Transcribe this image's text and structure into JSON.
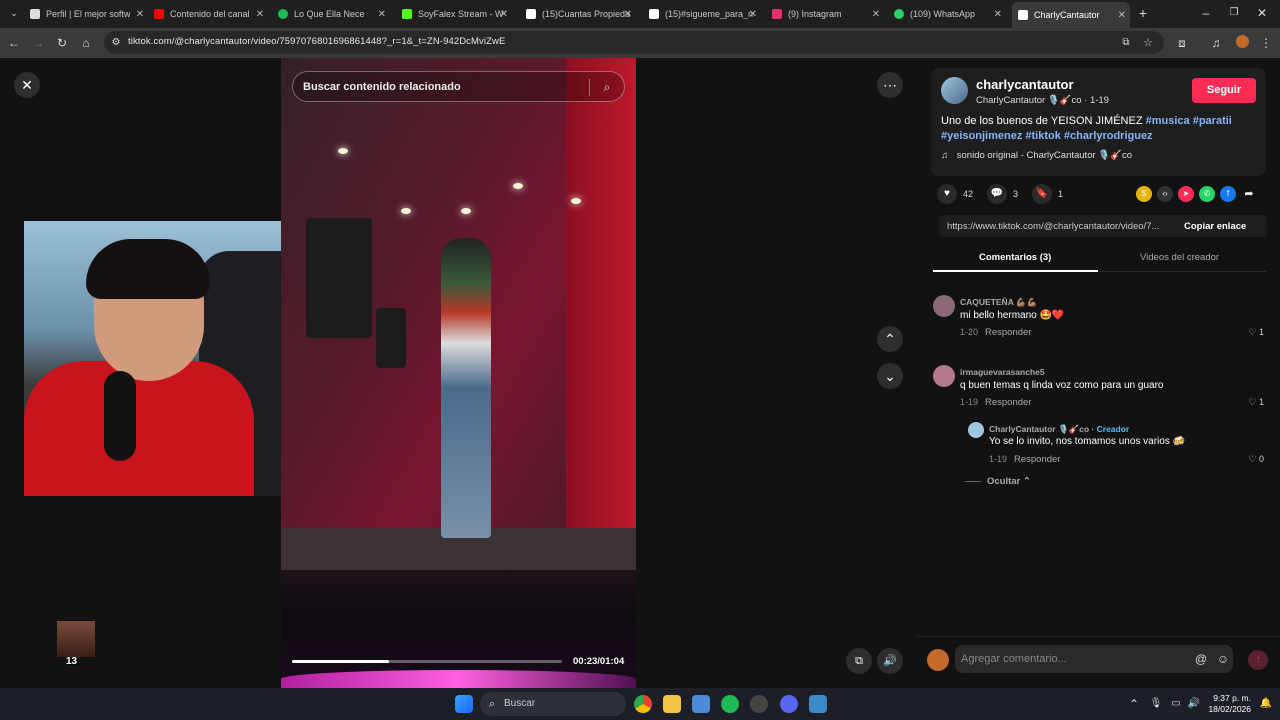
{
  "browser": {
    "tabs": [
      {
        "label": "Perfil | El mejor softw",
        "favicon": "generic-icon",
        "color": "#ffffff",
        "x": 0
      },
      {
        "label": "Contenido del canal",
        "favicon": "youtube-icon",
        "color": "#ff0000"
      },
      {
        "label": "Lo Que Ella Nece",
        "favicon": "spotify-icon",
        "color": "#1db954"
      },
      {
        "label": "SoyFalex Stream - W",
        "favicon": "kick-icon",
        "color": "#53fc18"
      },
      {
        "label": "(15)Cuantas Propieda",
        "favicon": "tiktok-icon",
        "color": "#ffffff"
      },
      {
        "label": "(15)#sigueme_para_n",
        "favicon": "tiktok-icon",
        "color": "#ffffff"
      },
      {
        "label": "(9) Instagram",
        "favicon": "instagram-icon",
        "color": "#e1306c"
      },
      {
        "label": "(109) WhatsApp",
        "favicon": "whatsapp-icon",
        "color": "#25d366"
      },
      {
        "label": "CharlyCantautor",
        "favicon": "tiktok-icon",
        "color": "#ffffff"
      }
    ],
    "new_tab_label": "+",
    "url": "tiktok.com/@charlycantautor/video/7597076801696861448?_r=1&_t=ZN-942DcMviZwE"
  },
  "video": {
    "search_placeholder": "Buscar contenido relacionado",
    "time": "00:23/01:04",
    "progress": 0.36
  },
  "overlay": {
    "sticker_label": "13"
  },
  "post": {
    "author": "charlycantautor",
    "nick": "CharlyCantautor 🎙️🎸co · 1-19",
    "follow_label": "Seguir",
    "desc_text": "Uno de los buenos de YEISON JIMÉNEZ ",
    "tags": [
      "#musica",
      "#paratii",
      "#yeisonjimenez",
      "#tiktok",
      "#charlyrodriguez"
    ],
    "sound": "sonido original - CharlyCantautor 🎙️🎸co",
    "likes": "42",
    "comments": "3",
    "saves": "1",
    "link": "https://www.tiktok.com/@charlycantautor/video/7...",
    "copy_label": "Copiar enlace"
  },
  "panel_tabs": {
    "comments": "Comentarios (3)",
    "creator_videos": "Videos del creador"
  },
  "comments": [
    {
      "user": "CAQUETEÑA 💪🏽💪🏽",
      "text": "mi bello hermano 🤩❤️",
      "date": "1-20",
      "reply": "Responder",
      "likes": "1",
      "avatar_color": "#8a6a7a"
    },
    {
      "user": "irmaguevarasanche5",
      "text": "q buen temas q linda voz como para un guaro",
      "date": "1-19",
      "reply": "Responder",
      "likes": "1",
      "avatar_color": "#b07a8a"
    }
  ],
  "creator_reply": {
    "user": "CharlyCantautor 🎙️🎸co",
    "creator_label": "Creador",
    "text": "Yo se lo invito, nos tomamos unos varios 🍻",
    "date": "1-19",
    "reply": "Responder",
    "likes": "0"
  },
  "hide_label": "Ocultar ⌃",
  "composer": {
    "placeholder": "Agregar comentario..."
  },
  "taskbar": {
    "search_label": "Buscar",
    "time": "9:37 p. m.",
    "date": "18/02/2026"
  },
  "colors": {
    "accent": "#fe2c55",
    "tag": "#8ab4f8",
    "creator": "#4cc4ff"
  }
}
